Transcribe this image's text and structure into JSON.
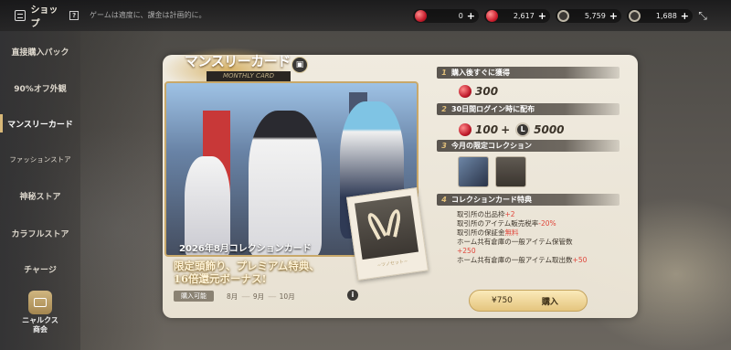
{
  "topbar": {
    "shop_label": "ショップ",
    "help": "?",
    "notice": "ゲームは適度に、課金は計画的に。",
    "currencies": [
      {
        "icon": "red-gem-icon",
        "value": "0",
        "color": "#c51c2c"
      },
      {
        "icon": "red-gem-icon",
        "value": "2,617",
        "color": "#d02030"
      },
      {
        "icon": "coin-icon",
        "value": "5,759",
        "color": "#8a8578"
      },
      {
        "icon": "token-icon",
        "value": "1,688",
        "color": "#8a8578"
      }
    ],
    "plus": "+",
    "shrink_icon": "shrink-icon"
  },
  "sidebar": {
    "items": [
      {
        "label": "直接購入パック"
      },
      {
        "label": "90%オフ外観"
      },
      {
        "label": "マンスリーカード"
      },
      {
        "label": "ファッションストア"
      },
      {
        "label": "神秘ストア"
      },
      {
        "label": "カラフルストア"
      },
      {
        "label": "チャージ"
      }
    ],
    "nyarukusu_line1": "ニャルクス",
    "nyarukusu_line2": "商会"
  },
  "card": {
    "title": "マンスリーカード",
    "subtitle": "MONTHLY CARD",
    "art_caption": "2026年8月コレクションカード",
    "polaroid_label": "~ツノセット~",
    "promo_line1": "限定頭飾り、プレミアム特典、",
    "promo_line2": "16倍還元ボーナス!",
    "buy_available": "購入可能",
    "months": [
      "8月",
      "9月",
      "10月"
    ],
    "info": "i"
  },
  "rewards": {
    "r1_num": "1",
    "r1_title": "購入後すぐに獲得",
    "r1_value": "300",
    "r2_num": "2",
    "r2_title": "30日間ログイン時に配布",
    "r2_value_gem": "100",
    "r2_plus": "+",
    "r2_value_coin": "5000",
    "r3_num": "3",
    "r3_title": "今月の限定コレクション",
    "r4_num": "4",
    "r4_title": "コレクションカード特典",
    "perk1": "取引所の出品枠",
    "perk1_val": "+2",
    "perk2": "取引所のアイテム販売税率",
    "perk2_val": "-20%",
    "perk3": "取引所の保証金",
    "perk3_val": "無料",
    "perk4": "ホーム共有倉庫の一般アイテム保管数",
    "perk4_val": "+250",
    "perk5": "ホーム共有倉庫の一般アイテム取出数",
    "perk5_val": "+50"
  },
  "purchase": {
    "price": "¥750",
    "button": "購入"
  }
}
